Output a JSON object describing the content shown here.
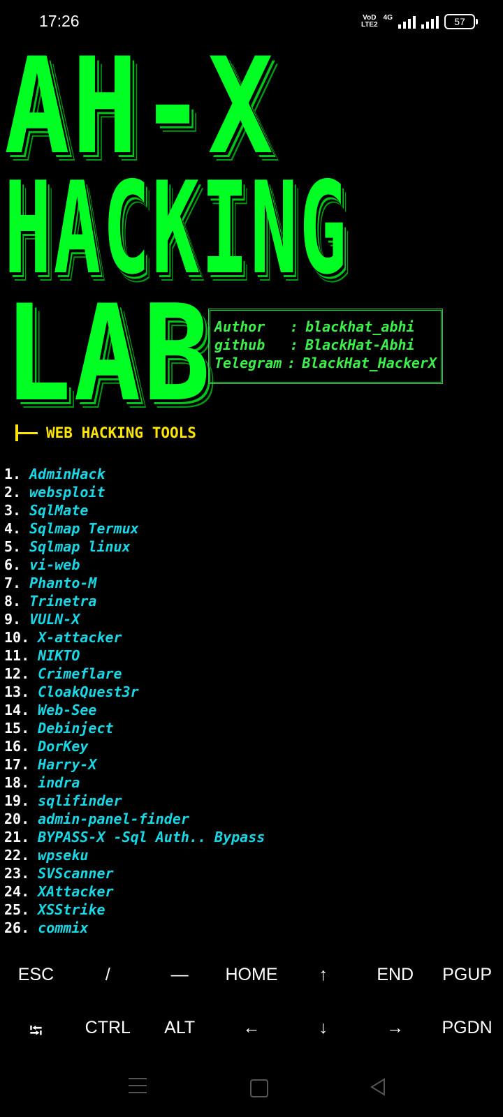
{
  "status_bar": {
    "time": "17:26",
    "volte_top": "VoD",
    "volte_bottom": "LTE2",
    "network": "4G",
    "battery": "57"
  },
  "banner": {
    "line1": "AH-X",
    "line2": "HACKING",
    "line3": "LAB",
    "info": [
      {
        "key": "Author",
        "sep": ":",
        "value": "blackhat_abhi"
      },
      {
        "key": "github",
        "sep": ":",
        "value": "BlackHat-Abhi"
      },
      {
        "key": "Telegram",
        "sep": ":",
        "value": "BlackHat_HackerX"
      }
    ]
  },
  "section": {
    "title": "WEB HACKING TOOLS"
  },
  "tools": [
    {
      "num": "1.",
      "name": "AdminHack"
    },
    {
      "num": "2.",
      "name": "websploit"
    },
    {
      "num": "3.",
      "name": "SqlMate"
    },
    {
      "num": "4.",
      "name": "Sqlmap Termux"
    },
    {
      "num": "5.",
      "name": "Sqlmap linux"
    },
    {
      "num": "6.",
      "name": "vi-web"
    },
    {
      "num": "7.",
      "name": "Phanto-M"
    },
    {
      "num": "8.",
      "name": "Trinetra"
    },
    {
      "num": "9.",
      "name": "VULN-X"
    },
    {
      "num": "10.",
      "name": "X-attacker"
    },
    {
      "num": "11.",
      "name": "NIKTO"
    },
    {
      "num": "12.",
      "name": "Crimeflare"
    },
    {
      "num": "13.",
      "name": "CloakQuest3r"
    },
    {
      "num": "14.",
      "name": "Web-See"
    },
    {
      "num": "15.",
      "name": "Debinject"
    },
    {
      "num": "16.",
      "name": "DorKey"
    },
    {
      "num": "17.",
      "name": "Harry-X"
    },
    {
      "num": "18.",
      "name": "indra"
    },
    {
      "num": "19.",
      "name": "sqlifinder"
    },
    {
      "num": "20.",
      "name": "admin-panel-finder"
    },
    {
      "num": "21.",
      "name": "BYPASS-X -Sql Auth.. Bypass"
    },
    {
      "num": "22.",
      "name": "wpseku"
    },
    {
      "num": "23.",
      "name": "SVScanner"
    },
    {
      "num": "24.",
      "name": "XAttacker"
    },
    {
      "num": "25.",
      "name": "XSStrike"
    },
    {
      "num": "26.",
      "name": "commix"
    }
  ],
  "extra_keys": {
    "row1": [
      "ESC",
      "/",
      "—",
      "HOME",
      "↑",
      "END",
      "PGUP"
    ],
    "row2": [
      "⭾",
      "CTRL",
      "ALT",
      "←",
      "↓",
      "→",
      "PGDN"
    ]
  },
  "colors": {
    "banner_green": "#00ff22",
    "section_yellow": "#ffe600",
    "tool_cyan": "#18d8e6"
  }
}
